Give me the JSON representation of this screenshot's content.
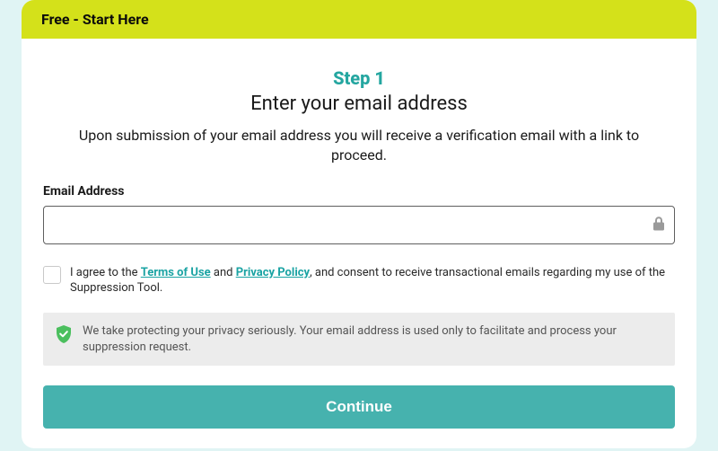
{
  "header": {
    "title": "Free - Start Here"
  },
  "step": {
    "label": "Step 1",
    "subtitle": "Enter your email address",
    "description": "Upon submission of your email address you will receive a verification email with a link to proceed."
  },
  "form": {
    "email_label": "Email Address",
    "email_value": "",
    "email_placeholder": ""
  },
  "consent": {
    "prefix": "I agree to the ",
    "terms_link": "Terms of Use",
    "and": " and ",
    "privacy_link": "Privacy Policy",
    "suffix": ", and consent to receive transactional emails regarding my use of the Suppression Tool."
  },
  "privacy_notice": "We take protecting your privacy seriously. Your email address is used only to facilitate and process your suppression request.",
  "actions": {
    "continue_label": "Continue"
  },
  "colors": {
    "accent": "#46b2ae",
    "header_bg": "#d4e11a"
  }
}
